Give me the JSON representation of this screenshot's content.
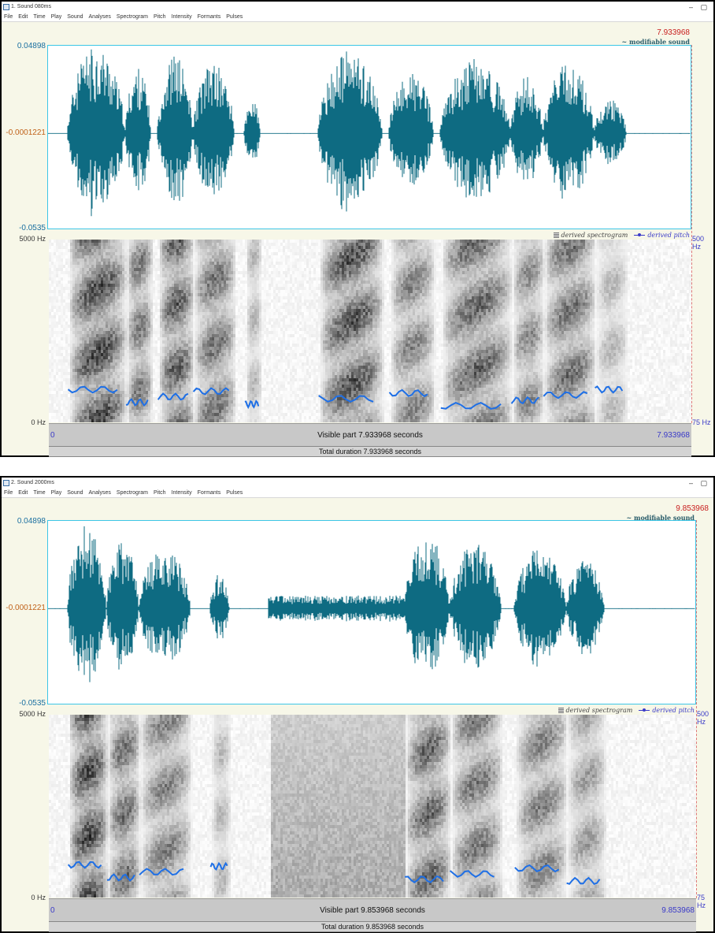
{
  "windows": [
    {
      "title": "1. Sound 080ms",
      "menu": [
        "File",
        "Edit",
        "Time",
        "Play",
        "Sound",
        "Analyses",
        "Spectrogram",
        "Pitch",
        "Intensity",
        "Formants",
        "Pulses"
      ],
      "amp_top": "0.04898",
      "amp_mid": "-0.0001221",
      "amp_bottom": "-0.0535",
      "right_time": "7.933968",
      "modifiable_label": "~ modifiable sound",
      "freq_top": "5000 Hz",
      "freq_bottom": "0 Hz",
      "pitch_top": "500 Hz",
      "pitch_bottom": "75 Hz",
      "legend_spectrogram": "derived spectrogram",
      "legend_pitch": "derived pitch",
      "time_start": "0",
      "time_end": "7.933968",
      "visible_text": "Visible part 7.933968 seconds",
      "total_text": "Total duration 7.933968 seconds",
      "speech_segments": [
        [
          0.03,
          0.12,
          1.0
        ],
        [
          0.12,
          0.16,
          0.75
        ],
        [
          0.17,
          0.225,
          0.9
        ],
        [
          0.225,
          0.29,
          0.8
        ],
        [
          0.305,
          0.33,
          0.4
        ],
        [
          0.42,
          0.52,
          0.95
        ],
        [
          0.53,
          0.6,
          0.7
        ],
        [
          0.61,
          0.72,
          0.85
        ],
        [
          0.72,
          0.77,
          0.65
        ],
        [
          0.77,
          0.85,
          0.8
        ],
        [
          0.85,
          0.9,
          0.4
        ]
      ],
      "pitch_contour": [
        [
          0.03,
          0.84
        ],
        [
          0.06,
          0.83
        ],
        [
          0.1,
          0.82
        ],
        [
          0.13,
          0.86
        ],
        [
          0.16,
          0.84
        ],
        [
          0.19,
          0.81
        ],
        [
          0.22,
          0.83
        ],
        [
          0.25,
          0.89
        ],
        [
          0.27,
          0.92
        ],
        [
          0.3,
          0.94
        ]
      ]
    },
    {
      "title": "2. Sound 2000ms",
      "menu": [
        "File",
        "Edit",
        "Time",
        "Play",
        "Sound",
        "Analyses",
        "Spectrogram",
        "Pitch",
        "Intensity",
        "Formants",
        "Pulses"
      ],
      "amp_top": "0.04898",
      "amp_mid": "-0.0001221",
      "amp_bottom": "-0.0535",
      "right_time": "9.853968",
      "modifiable_label": "~ modifiable sound",
      "freq_top": "5000 Hz",
      "freq_bottom": "0 Hz",
      "pitch_top": "500 Hz",
      "pitch_bottom": "75 Hz",
      "legend_spectrogram": "derived spectrogram",
      "legend_pitch": "derived pitch",
      "time_start": "0",
      "time_end": "9.853968",
      "visible_text": "Visible part 9.853968 seconds",
      "total_text": "Total duration 9.853968 seconds",
      "speech_segments": [
        [
          0.03,
          0.09,
          1.0
        ],
        [
          0.09,
          0.14,
          0.8
        ],
        [
          0.14,
          0.22,
          0.7
        ],
        [
          0.25,
          0.28,
          0.4
        ],
        [
          0.55,
          0.62,
          0.85
        ],
        [
          0.62,
          0.7,
          0.75
        ],
        [
          0.72,
          0.8,
          0.7
        ],
        [
          0.8,
          0.86,
          0.55
        ]
      ],
      "noise_segment": [
        0.34,
        0.55,
        0.15
      ]
    }
  ]
}
